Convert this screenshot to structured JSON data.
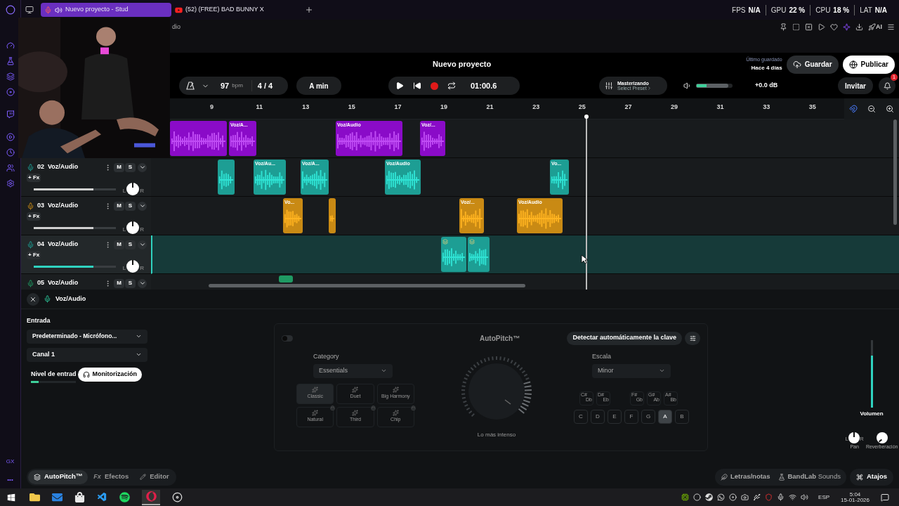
{
  "browser": {
    "tabs": [
      {
        "title": "Nuevo proyecto - Stud",
        "selected": true,
        "audio": true
      },
      {
        "title": "(52) (FREE) BAD BUNNY X",
        "selected": false,
        "audio": false
      }
    ],
    "page_fragment": "dio",
    "stats": [
      {
        "label": "FPS",
        "value": "N/A"
      },
      {
        "label": "GPU",
        "value": "22 %"
      },
      {
        "label": "CPU",
        "value": "18 %"
      },
      {
        "label": "LAT",
        "value": "N/A"
      }
    ],
    "ai_label": "AI",
    "sidebar_footer": "GX",
    "sidebar_more": "•••"
  },
  "project": {
    "title": "Nuevo proyecto",
    "last_saved_label": "Último guardado",
    "last_saved": "Hace 4 días",
    "save": "Guardar",
    "publish": "Publicar"
  },
  "toolbar": {
    "tempo": "97",
    "tempo_unit": "bpm",
    "time_signature": "4 / 4",
    "key": "A min",
    "time": "01:00.6",
    "mastering": {
      "title": "Masterizando",
      "preset": "Select Preset"
    },
    "master_volume": {
      "level": 0.88,
      "reading": "+0.0 dB"
    },
    "invite": "Invitar",
    "notifications": "1"
  },
  "ruler": [
    "9",
    "11",
    "13",
    "15",
    "17",
    "19",
    "21",
    "23",
    "25",
    "27",
    "29",
    "31",
    "33",
    "35"
  ],
  "tracks": [
    {
      "color": "#8a0bc8",
      "selected": false,
      "clips": [
        {
          "icon": false
        },
        {
          "title": "Voz/A...",
          "icon": false
        },
        {
          "title": "Voz/Audio",
          "icon": false
        },
        {
          "title": "Voz/...",
          "icon": false
        }
      ]
    },
    {
      "number": "02",
      "name": "Voz/Audio",
      "mute": "M",
      "solo": "S",
      "fx": "+ Fx",
      "level": 0.73,
      "pan_left": "L",
      "pan_right": "R",
      "color": "#1d9e94",
      "selected": false,
      "clips": [
        {
          "icon": false
        },
        {
          "title": "Voz/Au...",
          "icon": false
        },
        {
          "title": "Voz/A...",
          "icon": false
        },
        {
          "title": "Voz/Audio",
          "icon": false
        },
        {
          "title": "Vo...",
          "icon": false
        }
      ]
    },
    {
      "number": "03",
      "name": "Voz/Audio",
      "mute": "M",
      "solo": "S",
      "fx": "+ Fx",
      "level": 0.73,
      "pan_left": "L",
      "pan_right": "R",
      "color": "#c98a14",
      "selected": false,
      "clips": [
        {
          "title": "Vo...",
          "icon": false
        },
        {
          "icon": false
        },
        {
          "title": "Voz/...",
          "icon": false
        },
        {
          "title": "Voz/Audio",
          "icon": false
        }
      ]
    },
    {
      "number": "04",
      "name": "Voz/Audio",
      "mute": "M",
      "solo": "S",
      "fx": "+ Fx",
      "level": 0.73,
      "pan_left": "L",
      "pan_right": "R",
      "color": "#1d9e94",
      "selected": true,
      "clips": [
        {
          "icon": true
        },
        {
          "icon": true
        }
      ]
    },
    {
      "number": "05",
      "name": "Voz/Audio",
      "mute": "M",
      "solo": "S",
      "color": "#1f9a63",
      "selected": false,
      "clips": [
        {
          "icon": false
        }
      ]
    }
  ],
  "inspector": {
    "title": "Voz/Audio",
    "input_label": "Entrada",
    "device": "Predeterminado - Micrófono...",
    "channel": "Canal 1",
    "input_level_label": "Nivel de entrad",
    "input_level": {
      "level": 0.17
    },
    "monitoring": "Monitorización"
  },
  "autopitch": {
    "on": false,
    "title": "AutoPitch™",
    "detect_key": "Detectar automáticamente la clave",
    "category_label": "Category",
    "category": "Essentials",
    "presets": [
      {
        "label": "Classic",
        "selected": true,
        "locked": false
      },
      {
        "label": "Duet",
        "selected": false,
        "locked": false
      },
      {
        "label": "Big Harmony",
        "selected": false,
        "locked": false
      },
      {
        "label": "Natural",
        "selected": false,
        "locked": true
      },
      {
        "label": "Third",
        "selected": false,
        "locked": true
      },
      {
        "label": "Chip",
        "selected": false,
        "locked": true
      }
    ],
    "knob_label": "Lo más intenso",
    "scale_label": "Escala",
    "scale": "Minor",
    "sharps": [
      {
        "top": "C#",
        "bottom": "Db"
      },
      {
        "top": "D#",
        "bottom": "Eb"
      },
      {
        "top": "F#",
        "bottom": "Gb"
      },
      {
        "top": "G#",
        "bottom": "Ab"
      },
      {
        "top": "A#",
        "bottom": "Bb"
      }
    ],
    "notes": [
      {
        "label": "C",
        "selected": false
      },
      {
        "label": "D",
        "selected": false
      },
      {
        "label": "E",
        "selected": false
      },
      {
        "label": "F",
        "selected": false
      },
      {
        "label": "G",
        "selected": false
      },
      {
        "label": "A",
        "selected": true
      },
      {
        "label": "B",
        "selected": false
      }
    ]
  },
  "mixer": {
    "volume": {
      "label": "Volumen",
      "level": 0.77
    },
    "pan": {
      "label": "Pan",
      "left": "L",
      "right": "R"
    },
    "reverb": {
      "label": "Reverberación"
    }
  },
  "bottom_tabs": [
    {
      "label": "AutoPitch™",
      "selected": true
    },
    {
      "label": "Efectos",
      "icon_text": "Fx",
      "selected": false
    },
    {
      "label": "Editor",
      "selected": false
    }
  ],
  "bottom_links": {
    "lyrics": "Letras/notas",
    "sounds_brand": "BandLab",
    "sounds": "Sounds",
    "shortcuts": "Atajos"
  },
  "taskbar": {
    "language": "ESP",
    "time": "5:04",
    "date": "15-01-2026"
  }
}
